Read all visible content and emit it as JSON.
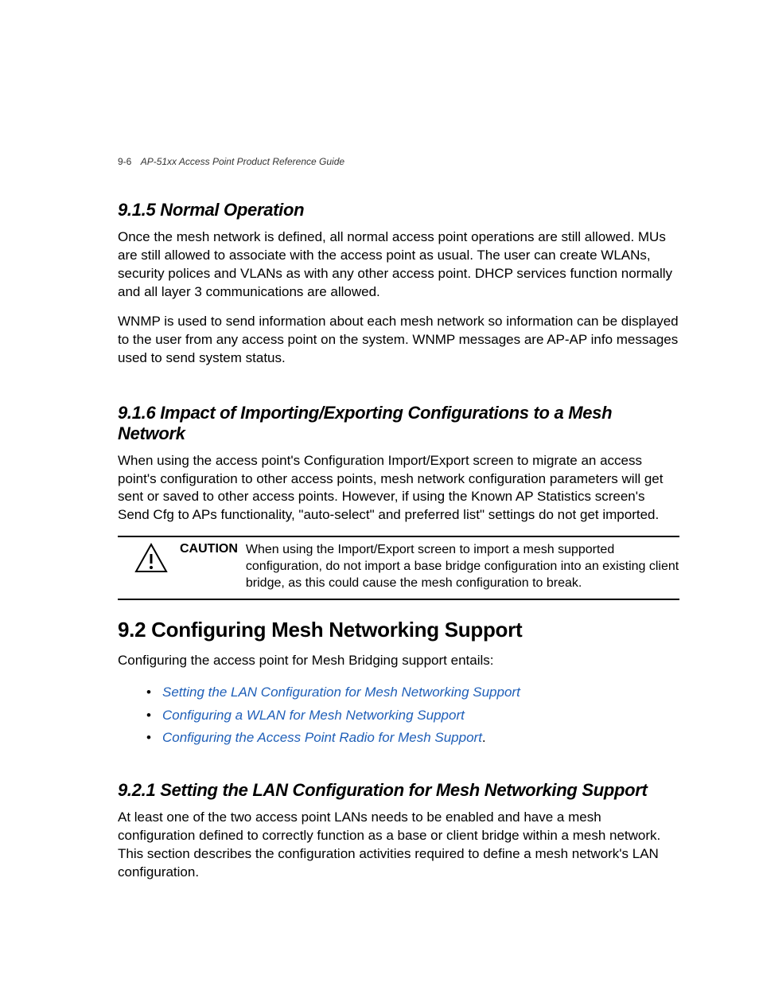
{
  "header": {
    "page_number": "9-6",
    "guide_title": "AP-51xx Access Point Product Reference Guide"
  },
  "section_915": {
    "heading": "9.1.5  Normal Operation",
    "p1": "Once the mesh network is defined, all normal access point operations are still allowed. MUs are still allowed to associate with the access point as usual. The user can create WLANs, security polices and VLANs as with any other access point. DHCP services function normally and all layer 3 communications are allowed.",
    "p2": "WNMP is used to send information about each mesh network so information can be displayed to the user from any access point on the system. WNMP messages are AP-AP info messages used to send system status."
  },
  "section_916": {
    "heading": "9.1.6  Impact of Importing/Exporting Configurations to a Mesh Network",
    "p1": "When using the access point's Configuration Import/Export screen to migrate an access point's configuration to other access points, mesh network configuration parameters will get sent or saved to other access points. However, if using the Known AP Statistics screen's Send Cfg to APs functionality, \"auto-select\" and preferred list\" settings do not get imported.",
    "caution_label": "CAUTION",
    "caution_text": "When using the Import/Export screen to import a mesh supported configuration, do not import a base bridge configuration into an existing client bridge, as this could cause the mesh configuration to break."
  },
  "section_92": {
    "heading": "9.2  Configuring Mesh Networking Support",
    "intro": "Configuring the access point for Mesh Bridging support entails:",
    "links": [
      "Setting the LAN Configuration for Mesh Networking Support",
      "Configuring a WLAN for Mesh Networking Support",
      "Configuring the Access Point Radio for Mesh Support"
    ]
  },
  "section_921": {
    "heading": "9.2.1  Setting the LAN Configuration for Mesh Networking Support",
    "p1": "At least one of the two access point LANs needs to be enabled and have a mesh configuration defined to correctly function as a base or client bridge within a mesh network. This section describes the configuration activities required to define a mesh network's LAN configuration."
  }
}
